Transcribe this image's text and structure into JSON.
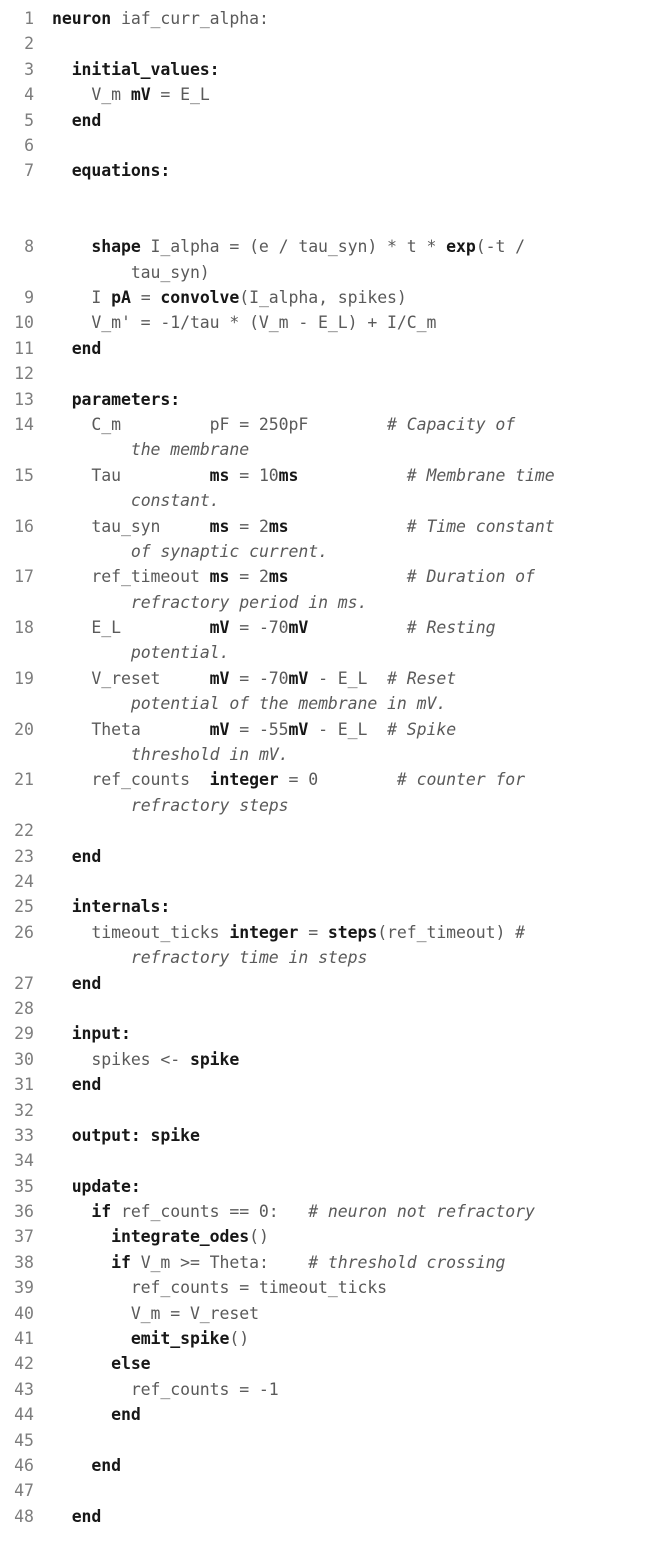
{
  "document": {
    "kind": "code-listing",
    "language": "NESTML",
    "model_name": "iaf_curr_alpha",
    "total_lines": 48,
    "colors": {
      "background": "#ffffff",
      "line_number": "#7d7d7d",
      "code_regular": "#5a5a5a",
      "code_keyword": "#171717",
      "comment": "#5a5a5a"
    }
  },
  "lines": [
    {
      "number": "1",
      "gap_before": false,
      "tokens": [
        {
          "text": "neuron ",
          "style": "bold"
        },
        {
          "text": "iaf_curr_alpha:",
          "style": "plain"
        }
      ]
    },
    {
      "number": "2",
      "gap_before": false,
      "tokens": []
    },
    {
      "number": "3",
      "gap_before": false,
      "tokens": [
        {
          "text": "  initial_values:",
          "style": "bold"
        }
      ]
    },
    {
      "number": "4",
      "gap_before": false,
      "tokens": [
        {
          "text": "    V_m ",
          "style": "plain"
        },
        {
          "text": "mV",
          "style": "bold"
        },
        {
          "text": " = E_L",
          "style": "plain"
        }
      ]
    },
    {
      "number": "5",
      "gap_before": false,
      "tokens": [
        {
          "text": "  end",
          "style": "bold"
        }
      ]
    },
    {
      "number": "6",
      "gap_before": false,
      "tokens": []
    },
    {
      "number": "7",
      "gap_before": false,
      "tokens": [
        {
          "text": "  equations:",
          "style": "bold"
        }
      ]
    },
    {
      "number": "8",
      "gap_before": true,
      "tokens": [
        {
          "text": "    shape",
          "style": "bold"
        },
        {
          "text": " I_alpha = (e / tau_syn) * t * ",
          "style": "plain"
        },
        {
          "text": "exp",
          "style": "bold"
        },
        {
          "text": "(-t /",
          "style": "plain"
        }
      ]
    },
    {
      "number": "",
      "gap_before": false,
      "continuation": true,
      "tokens": [
        {
          "text": "        tau_syn)",
          "style": "plain"
        }
      ]
    },
    {
      "number": "9",
      "gap_before": false,
      "tokens": [
        {
          "text": "    I ",
          "style": "plain"
        },
        {
          "text": "pA",
          "style": "bold"
        },
        {
          "text": " = ",
          "style": "plain"
        },
        {
          "text": "convolve",
          "style": "bold"
        },
        {
          "text": "(I_alpha, spikes)",
          "style": "plain"
        }
      ]
    },
    {
      "number": "10",
      "gap_before": false,
      "tokens": [
        {
          "text": "    V_m' = -1/tau * (V_m - E_L) + I/C_m",
          "style": "plain"
        }
      ]
    },
    {
      "number": "11",
      "gap_before": false,
      "tokens": [
        {
          "text": "  end",
          "style": "bold"
        }
      ]
    },
    {
      "number": "12",
      "gap_before": false,
      "tokens": []
    },
    {
      "number": "13",
      "gap_before": false,
      "tokens": [
        {
          "text": "  parameters:",
          "style": "bold"
        }
      ]
    },
    {
      "number": "14",
      "gap_before": false,
      "tokens": [
        {
          "text": "    C_m         pF = 250pF        ",
          "style": "plain"
        },
        {
          "text": "# Capacity of",
          "style": "italic"
        }
      ]
    },
    {
      "number": "",
      "gap_before": false,
      "continuation": true,
      "tokens": [
        {
          "text": "        ",
          "style": "plain"
        },
        {
          "text": "the membrane",
          "style": "italic"
        }
      ]
    },
    {
      "number": "15",
      "gap_before": false,
      "tokens": [
        {
          "text": "    Tau         ",
          "style": "plain"
        },
        {
          "text": "ms",
          "style": "bold"
        },
        {
          "text": " = 10",
          "style": "plain"
        },
        {
          "text": "ms",
          "style": "bold"
        },
        {
          "text": "           ",
          "style": "plain"
        },
        {
          "text": "# Membrane time",
          "style": "italic"
        }
      ]
    },
    {
      "number": "",
      "gap_before": false,
      "continuation": true,
      "tokens": [
        {
          "text": "        ",
          "style": "plain"
        },
        {
          "text": "constant.",
          "style": "italic"
        }
      ]
    },
    {
      "number": "16",
      "gap_before": false,
      "tokens": [
        {
          "text": "    tau_syn     ",
          "style": "plain"
        },
        {
          "text": "ms",
          "style": "bold"
        },
        {
          "text": " = 2",
          "style": "plain"
        },
        {
          "text": "ms",
          "style": "bold"
        },
        {
          "text": "            ",
          "style": "plain"
        },
        {
          "text": "# Time constant",
          "style": "italic"
        }
      ]
    },
    {
      "number": "",
      "gap_before": false,
      "continuation": true,
      "tokens": [
        {
          "text": "        ",
          "style": "plain"
        },
        {
          "text": "of synaptic current.",
          "style": "italic"
        }
      ]
    },
    {
      "number": "17",
      "gap_before": false,
      "tokens": [
        {
          "text": "    ref_timeout ",
          "style": "plain"
        },
        {
          "text": "ms",
          "style": "bold"
        },
        {
          "text": " = 2",
          "style": "plain"
        },
        {
          "text": "ms",
          "style": "bold"
        },
        {
          "text": "            ",
          "style": "plain"
        },
        {
          "text": "# Duration of",
          "style": "italic"
        }
      ]
    },
    {
      "number": "",
      "gap_before": false,
      "continuation": true,
      "tokens": [
        {
          "text": "        ",
          "style": "plain"
        },
        {
          "text": "refractory period in ms.",
          "style": "italic"
        }
      ]
    },
    {
      "number": "18",
      "gap_before": false,
      "tokens": [
        {
          "text": "    E_L         ",
          "style": "plain"
        },
        {
          "text": "mV",
          "style": "bold"
        },
        {
          "text": " = -70",
          "style": "plain"
        },
        {
          "text": "mV",
          "style": "bold"
        },
        {
          "text": "          ",
          "style": "plain"
        },
        {
          "text": "# Resting",
          "style": "italic"
        }
      ]
    },
    {
      "number": "",
      "gap_before": false,
      "continuation": true,
      "tokens": [
        {
          "text": "        ",
          "style": "plain"
        },
        {
          "text": "potential.",
          "style": "italic"
        }
      ]
    },
    {
      "number": "19",
      "gap_before": false,
      "tokens": [
        {
          "text": "    V_reset     ",
          "style": "plain"
        },
        {
          "text": "mV",
          "style": "bold"
        },
        {
          "text": " = -70",
          "style": "plain"
        },
        {
          "text": "mV",
          "style": "bold"
        },
        {
          "text": " - E_L  ",
          "style": "plain"
        },
        {
          "text": "# Reset",
          "style": "italic"
        }
      ]
    },
    {
      "number": "",
      "gap_before": false,
      "continuation": true,
      "tokens": [
        {
          "text": "        ",
          "style": "plain"
        },
        {
          "text": "potential of the membrane in mV.",
          "style": "italic"
        }
      ]
    },
    {
      "number": "20",
      "gap_before": false,
      "tokens": [
        {
          "text": "    Theta       ",
          "style": "plain"
        },
        {
          "text": "mV",
          "style": "bold"
        },
        {
          "text": " = -55",
          "style": "plain"
        },
        {
          "text": "mV",
          "style": "bold"
        },
        {
          "text": " - E_L  ",
          "style": "plain"
        },
        {
          "text": "# Spike",
          "style": "italic"
        }
      ]
    },
    {
      "number": "",
      "gap_before": false,
      "continuation": true,
      "tokens": [
        {
          "text": "        ",
          "style": "plain"
        },
        {
          "text": "threshold in mV.",
          "style": "italic"
        }
      ]
    },
    {
      "number": "21",
      "gap_before": false,
      "tokens": [
        {
          "text": "    ref_counts  ",
          "style": "plain"
        },
        {
          "text": "integer",
          "style": "bold"
        },
        {
          "text": " = 0        ",
          "style": "plain"
        },
        {
          "text": "# counter for",
          "style": "italic"
        }
      ]
    },
    {
      "number": "",
      "gap_before": false,
      "continuation": true,
      "tokens": [
        {
          "text": "        ",
          "style": "plain"
        },
        {
          "text": "refractory steps",
          "style": "italic"
        }
      ]
    },
    {
      "number": "22",
      "gap_before": false,
      "tokens": []
    },
    {
      "number": "23",
      "gap_before": false,
      "tokens": [
        {
          "text": "  end",
          "style": "bold"
        }
      ]
    },
    {
      "number": "24",
      "gap_before": false,
      "tokens": []
    },
    {
      "number": "25",
      "gap_before": false,
      "tokens": [
        {
          "text": "  internals:",
          "style": "bold"
        }
      ]
    },
    {
      "number": "26",
      "gap_before": false,
      "tokens": [
        {
          "text": "    timeout_ticks ",
          "style": "plain"
        },
        {
          "text": "integer",
          "style": "bold"
        },
        {
          "text": " = ",
          "style": "plain"
        },
        {
          "text": "steps",
          "style": "bold"
        },
        {
          "text": "(ref_timeout) ",
          "style": "plain"
        },
        {
          "text": "#",
          "style": "italic"
        }
      ]
    },
    {
      "number": "",
      "gap_before": false,
      "continuation": true,
      "tokens": [
        {
          "text": "        ",
          "style": "plain"
        },
        {
          "text": "refractory time in steps",
          "style": "italic"
        }
      ]
    },
    {
      "number": "27",
      "gap_before": false,
      "tokens": [
        {
          "text": "  end",
          "style": "bold"
        }
      ]
    },
    {
      "number": "28",
      "gap_before": false,
      "tokens": []
    },
    {
      "number": "29",
      "gap_before": false,
      "tokens": [
        {
          "text": "  input:",
          "style": "bold"
        }
      ]
    },
    {
      "number": "30",
      "gap_before": false,
      "tokens": [
        {
          "text": "    spikes <- ",
          "style": "plain"
        },
        {
          "text": "spike",
          "style": "bold"
        }
      ]
    },
    {
      "number": "31",
      "gap_before": false,
      "tokens": [
        {
          "text": "  end",
          "style": "bold"
        }
      ]
    },
    {
      "number": "32",
      "gap_before": false,
      "tokens": []
    },
    {
      "number": "33",
      "gap_before": false,
      "tokens": [
        {
          "text": "  output:",
          "style": "bold"
        },
        {
          "text": " ",
          "style": "plain"
        },
        {
          "text": "spike",
          "style": "bold"
        }
      ]
    },
    {
      "number": "34",
      "gap_before": false,
      "tokens": []
    },
    {
      "number": "35",
      "gap_before": false,
      "tokens": [
        {
          "text": "  update:",
          "style": "bold"
        }
      ]
    },
    {
      "number": "36",
      "gap_before": false,
      "tokens": [
        {
          "text": "    if",
          "style": "bold"
        },
        {
          "text": " ref_counts == 0:   ",
          "style": "plain"
        },
        {
          "text": "# neuron not refractory",
          "style": "italic"
        }
      ]
    },
    {
      "number": "37",
      "gap_before": false,
      "tokens": [
        {
          "text": "      ",
          "style": "plain"
        },
        {
          "text": "integrate_odes",
          "style": "bold"
        },
        {
          "text": "()",
          "style": "plain"
        }
      ]
    },
    {
      "number": "38",
      "gap_before": false,
      "tokens": [
        {
          "text": "      if",
          "style": "bold"
        },
        {
          "text": " V_m >= Theta:    ",
          "style": "plain"
        },
        {
          "text": "# threshold crossing",
          "style": "italic"
        }
      ]
    },
    {
      "number": "39",
      "gap_before": false,
      "tokens": [
        {
          "text": "        ref_counts = timeout_ticks",
          "style": "plain"
        }
      ]
    },
    {
      "number": "40",
      "gap_before": false,
      "tokens": [
        {
          "text": "        V_m = V_reset",
          "style": "plain"
        }
      ]
    },
    {
      "number": "41",
      "gap_before": false,
      "tokens": [
        {
          "text": "        ",
          "style": "plain"
        },
        {
          "text": "emit_spike",
          "style": "bold"
        },
        {
          "text": "()",
          "style": "plain"
        }
      ]
    },
    {
      "number": "42",
      "gap_before": false,
      "tokens": [
        {
          "text": "      else",
          "style": "bold"
        }
      ]
    },
    {
      "number": "43",
      "gap_before": false,
      "tokens": [
        {
          "text": "        ref_counts = -1",
          "style": "plain"
        }
      ]
    },
    {
      "number": "44",
      "gap_before": false,
      "tokens": [
        {
          "text": "      end",
          "style": "bold"
        }
      ]
    },
    {
      "number": "45",
      "gap_before": false,
      "tokens": []
    },
    {
      "number": "46",
      "gap_before": false,
      "tokens": [
        {
          "text": "    end",
          "style": "bold"
        }
      ]
    },
    {
      "number": "47",
      "gap_before": false,
      "tokens": []
    },
    {
      "number": "48",
      "gap_before": false,
      "tokens": [
        {
          "text": "  end",
          "style": "bold"
        }
      ]
    }
  ]
}
